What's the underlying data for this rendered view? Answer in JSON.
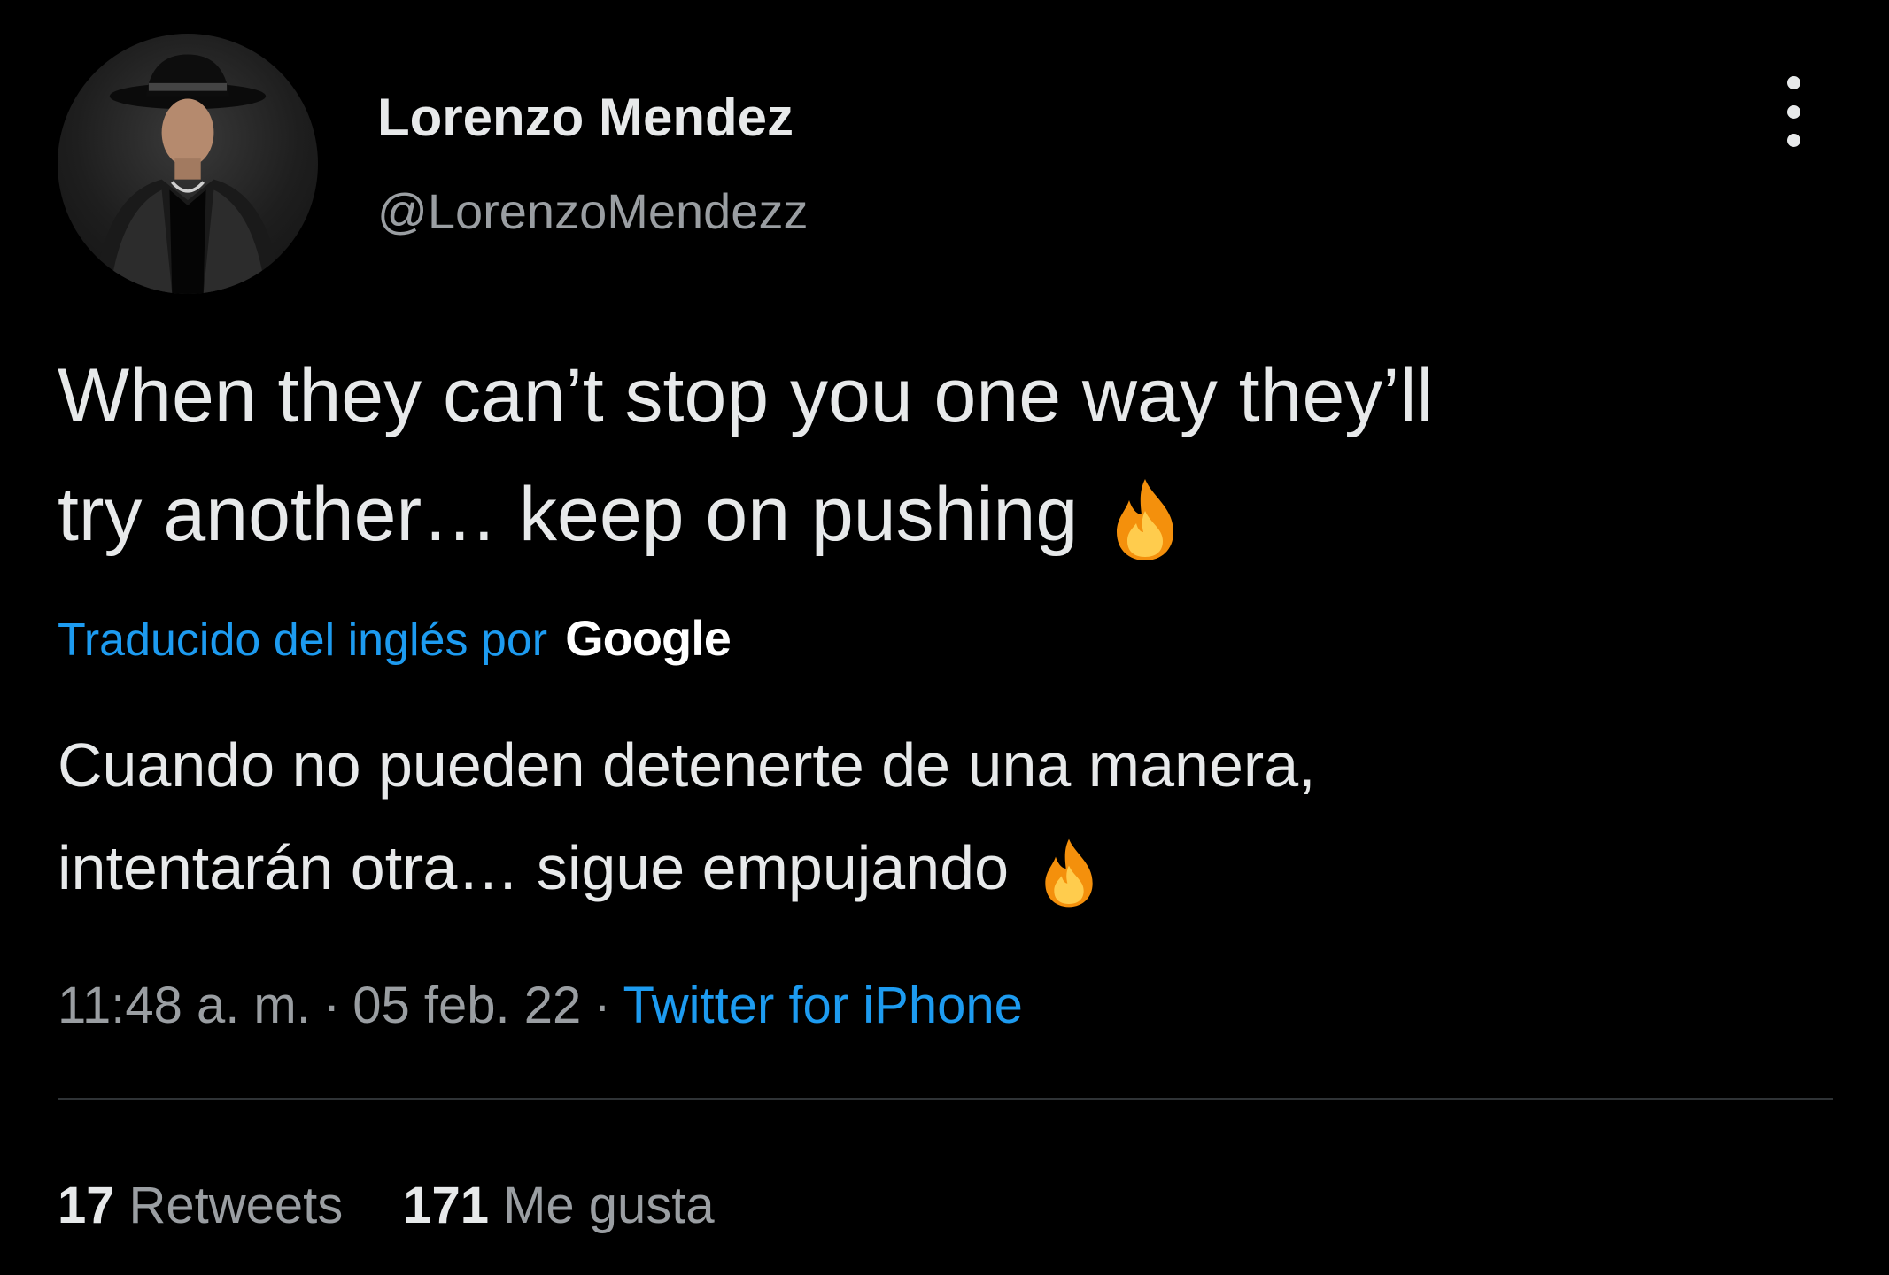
{
  "user": {
    "display_name": "Lorenzo Mendez",
    "handle": "@LorenzoMendezz"
  },
  "menu": {
    "icon": "more-vertical-icon"
  },
  "tweet": {
    "text": "When they can’t stop you one way they’ll\ntry another… keep on pushing",
    "emoji": "fire-emoji"
  },
  "translation": {
    "label": "Traducido del inglés por",
    "provider": "Google",
    "text": "Cuando no pueden detenerte de una manera,\nintentarán otra… sigue empujando"
  },
  "meta": {
    "time": "11:48 a. m.",
    "separator": "·",
    "date": "05 feb. 22",
    "source": "Twitter for iPhone"
  },
  "stats": {
    "retweets_count": "17",
    "retweets_label": "Retweets",
    "likes_count": "171",
    "likes_label": "Me gusta"
  },
  "colors": {
    "background": "#000000",
    "text": "#e7e9ea",
    "secondary": "#9a9ea2",
    "link": "#1d9bf0",
    "divider": "#2f3336"
  }
}
